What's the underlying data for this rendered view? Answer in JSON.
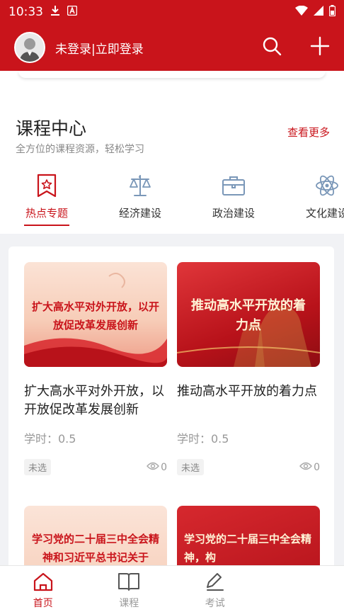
{
  "status_bar": {
    "time": "10:33"
  },
  "header": {
    "login_text": "未登录|立即登录"
  },
  "course_center": {
    "title": "课程中心",
    "subtitle": "全方位的课程资源，轻松学习",
    "more": "查看更多"
  },
  "categories": [
    {
      "label": "热点专题",
      "icon": "bookmark-star-icon",
      "active": true
    },
    {
      "label": "经济建设",
      "icon": "scales-icon",
      "active": false
    },
    {
      "label": "政治建设",
      "icon": "briefcase-icon",
      "active": false
    },
    {
      "label": "文化建设",
      "icon": "atom-icon",
      "active": false
    }
  ],
  "courses": [
    {
      "thumb_text": "扩大高水平对外开放，以开放促改革发展创新",
      "title": "扩大高水平对外开放，以开放促改革发展创新",
      "hours": "学时：0.5",
      "status": "未选",
      "views": "0"
    },
    {
      "thumb_text": "推动高水平开放的着力点",
      "title": "推动高水平开放的着力点",
      "hours": "学时：0.5",
      "status": "未选",
      "views": "0"
    },
    {
      "thumb_text": "学习党的二十届三中全会精神和习近平总书记关于",
      "title": "",
      "hours": "",
      "status": "",
      "views": ""
    },
    {
      "thumb_text": "学习党的二十届三中全会精神，构",
      "title": "",
      "hours": "",
      "status": "",
      "views": ""
    }
  ],
  "bottom_nav": [
    {
      "label": "首页",
      "icon": "home-icon",
      "active": true
    },
    {
      "label": "课程",
      "icon": "book-icon",
      "active": false
    },
    {
      "label": "考试",
      "icon": "edit-icon",
      "active": false
    },
    {
      "label": "",
      "icon": "",
      "active": false
    }
  ],
  "colors": {
    "brand_red": "#c9141b"
  }
}
